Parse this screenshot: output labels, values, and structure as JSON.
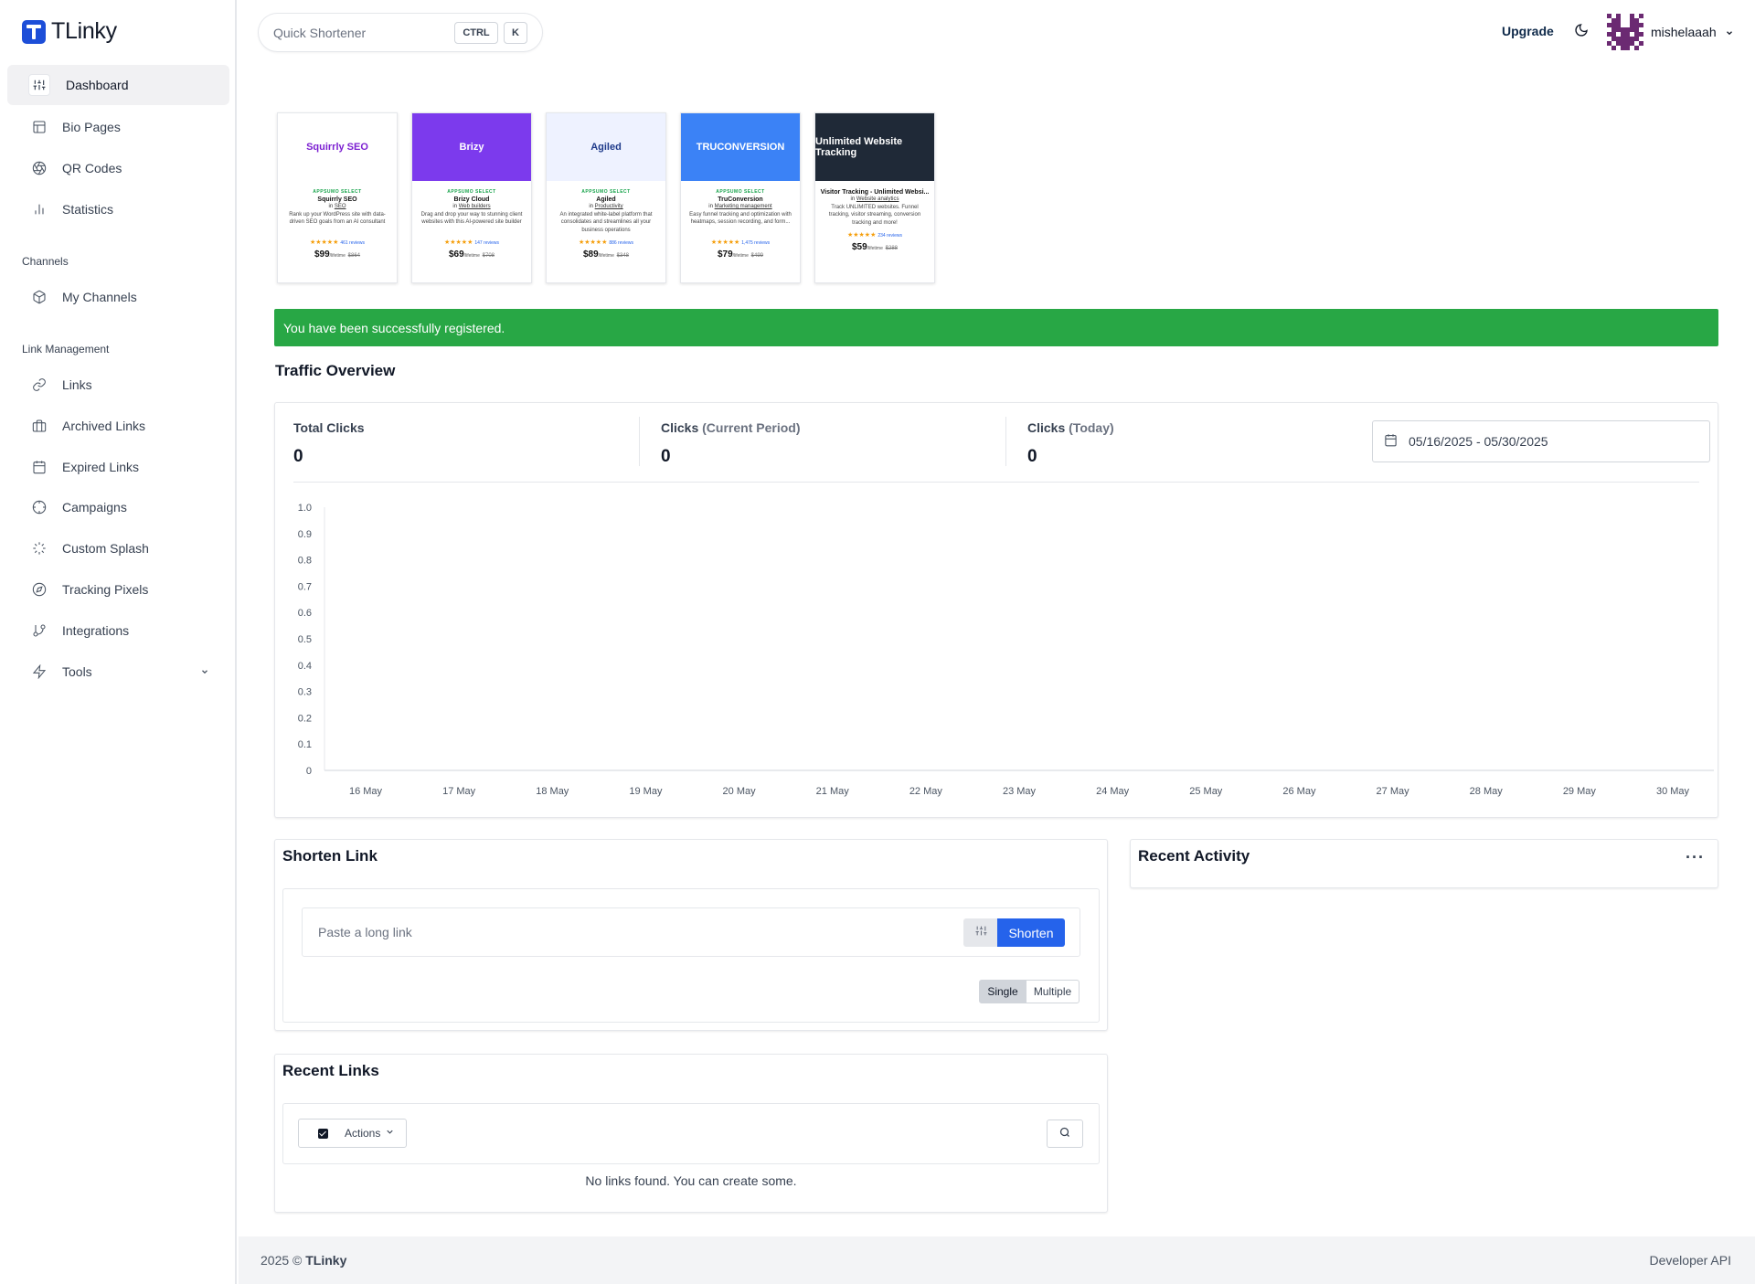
{
  "app": {
    "name": "TLinky"
  },
  "sidebar": {
    "items": [
      {
        "label": "Dashboard",
        "icon": "sliders-icon"
      },
      {
        "label": "Bio Pages",
        "icon": "layout-icon"
      },
      {
        "label": "QR Codes",
        "icon": "aperture-icon"
      },
      {
        "label": "Statistics",
        "icon": "bar-chart-icon"
      }
    ],
    "channels_heading": "Channels",
    "channels": [
      {
        "label": "My Channels",
        "icon": "box-icon"
      }
    ],
    "link_mgmt_heading": "Link Management",
    "link_mgmt": [
      {
        "label": "Links",
        "icon": "link-icon"
      },
      {
        "label": "Archived Links",
        "icon": "archive-icon"
      },
      {
        "label": "Expired Links",
        "icon": "calendar-icon"
      },
      {
        "label": "Campaigns",
        "icon": "target-icon"
      },
      {
        "label": "Custom Splash",
        "icon": "loader-icon"
      },
      {
        "label": "Tracking Pixels",
        "icon": "compass-icon"
      },
      {
        "label": "Integrations",
        "icon": "git-branch-icon"
      },
      {
        "label": "Tools",
        "icon": "zap-icon"
      }
    ]
  },
  "topbar": {
    "quick_placeholder": "Quick Shortener",
    "kbd_ctrl": "CTRL",
    "kbd_k": "K",
    "upgrade": "Upgrade",
    "username": "mishelaaah"
  },
  "ads": [
    {
      "title": "Squirrly SEO",
      "badge": "APPSUMO SELECT",
      "name": "Squirrly SEO",
      "in": "in",
      "category": "SEO",
      "desc": "Rank up your WordPress site with data-driven SEO goals from an AI consultant",
      "reviews": "461 reviews",
      "price": "$99",
      "per": "/lifetime",
      "old": "$864",
      "bg": "#ffffff",
      "fg": "#7c1fd1"
    },
    {
      "title": "Brizy",
      "badge": "APPSUMO SELECT",
      "name": "Brizy Cloud",
      "in": "in",
      "category": "Web builders",
      "desc": "Drag and drop your way to stunning client websites with this AI-powered site builder",
      "reviews": "147 reviews",
      "price": "$69",
      "per": "/lifetime",
      "old": "$708",
      "bg": "#7c3aed",
      "fg": "#ffffff"
    },
    {
      "title": "Agiled",
      "badge": "APPSUMO SELECT",
      "name": "Agiled",
      "in": "in",
      "category": "Productivity",
      "desc": "An integrated white-label platform that consolidates and streamlines all your business operations",
      "reviews": "886 reviews",
      "price": "$89",
      "per": "/lifetime",
      "old": "$348",
      "bg": "#eef2ff",
      "fg": "#1e3a8a"
    },
    {
      "title": "TRUCONVERSION",
      "badge": "APPSUMO SELECT",
      "name": "TruConversion",
      "in": "in",
      "category": "Marketing management",
      "desc": "Easy funnel tracking and optimization with heatmaps, session recording, and form...",
      "reviews": "1,475 reviews",
      "price": "$79",
      "per": "/lifetime",
      "old": "$499",
      "bg": "#3b82f6",
      "fg": "#ffffff"
    },
    {
      "title": "Unlimited Website Tracking",
      "badge": "",
      "name": "Visitor Tracking - Unlimited Websi...",
      "in": "in",
      "category": "Website analytics",
      "desc": "Track UNLIMITED websites. Funnel tracking, visitor streaming, conversion tracking and more!",
      "reviews": "234 reviews",
      "price": "$59",
      "per": "/lifetime",
      "old": "$288",
      "bg": "#1f2937",
      "fg": "#ffffff"
    }
  ],
  "alert": "You have been successfully registered.",
  "traffic": {
    "heading": "Traffic Overview",
    "total_label": "Total Clicks",
    "total_value": "0",
    "current_label": "Clicks",
    "current_suffix": "(Current Period)",
    "current_value": "0",
    "today_label": "Clicks",
    "today_suffix": "(Today)",
    "today_value": "0",
    "date_range": "05/16/2025 - 05/30/2025"
  },
  "chart_data": {
    "type": "line",
    "x": [
      "16 May",
      "17 May",
      "18 May",
      "19 May",
      "20 May",
      "21 May",
      "22 May",
      "23 May",
      "24 May",
      "25 May",
      "26 May",
      "27 May",
      "28 May",
      "29 May",
      "30 May"
    ],
    "series": [
      {
        "values": [
          0,
          0,
          0,
          0,
          0,
          0,
          0,
          0,
          0,
          0,
          0,
          0,
          0,
          0,
          0
        ]
      }
    ],
    "y_ticks": [
      "1.0",
      "0.9",
      "0.8",
      "0.7",
      "0.6",
      "0.5",
      "0.4",
      "0.3",
      "0.2",
      "0.1",
      "0"
    ],
    "ylim": [
      0,
      1
    ],
    "grid": false
  },
  "shorten": {
    "heading": "Shorten Link",
    "placeholder": "Paste a long link",
    "button": "Shorten",
    "single": "Single",
    "multiple": "Multiple"
  },
  "activity": {
    "heading": "Recent Activity",
    "menu": "···"
  },
  "recent_links": {
    "heading": "Recent Links",
    "actions": "Actions",
    "empty": "No links found. You can create some."
  },
  "footer": {
    "copyright": "2025 ©",
    "brand": "TLinky",
    "api": "Developer API"
  }
}
